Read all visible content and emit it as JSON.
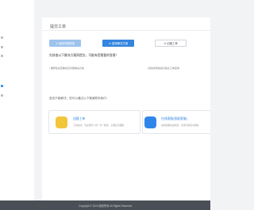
{
  "sidebar": {
    "items": [
      {
        "label": ""
      },
      {
        "label": ""
      },
      {
        "label": ""
      },
      {
        "label": ""
      },
      {
        "label": ""
      }
    ]
  },
  "page": {
    "title": "提交工单"
  },
  "steps": [
    {
      "label": "① 选择问题类型",
      "state": "done"
    },
    {
      "label": "② 选择解决方案",
      "state": "active"
    },
    {
      "label": "③ 创建工单",
      "state": "pending"
    }
  ],
  "content": {
    "heading": "先排查以下解决方案再提交，可能有您需要的答案！",
    "tip_left": "• 推荐您先查看常见问题解决方案",
    "tip_right": "• 如未找到答案可提交工单咨询",
    "sub_heading": "若还不能解决，您可以通过以下渠道联系我们："
  },
  "cards": [
    {
      "title": "创建工单",
      "desc": "工单在线，专业服务人员一对一解答，全程记录跟踪"
    },
    {
      "title": "在线客服(智能客服)",
      "desc": "在线客服快速响应，智能问答实时解答"
    }
  ],
  "footer": {
    "text": "Copyright © 2024 版权所有 All Rights Reserved"
  },
  "colors": {
    "accent": "#3385e0",
    "step_done": "#9cc3ec",
    "footer_bg": "#4a4f57",
    "card1_icon": "#f1c63a",
    "card2_icon": "#2f86ea"
  }
}
